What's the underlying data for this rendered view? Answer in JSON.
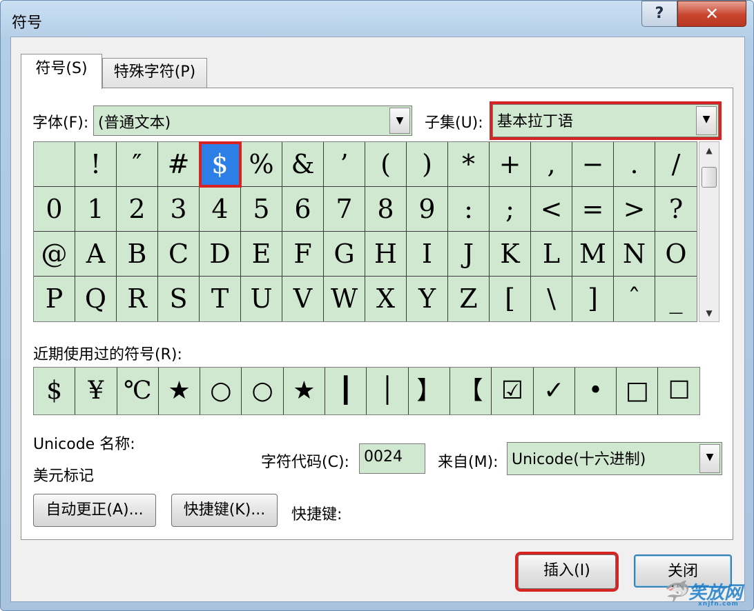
{
  "window": {
    "title": "符号",
    "help": "?",
    "close": "✕"
  },
  "tabs": [
    {
      "label": "符号(S)",
      "active": true
    },
    {
      "label": "特殊字符(P)",
      "active": false
    }
  ],
  "font": {
    "label": "字体(F):",
    "value": "(普通文本)",
    "arrow": "▼"
  },
  "subset": {
    "label": "子集(U):",
    "value": "基本拉丁语",
    "arrow": "▼"
  },
  "symbol_grid": {
    "rows": [
      [
        " ",
        "!",
        "″",
        "#",
        "$",
        "%",
        "&",
        "’",
        "(",
        ")",
        "*",
        "+",
        ",",
        "−",
        ".",
        "/"
      ],
      [
        "0",
        "1",
        "2",
        "3",
        "4",
        "5",
        "6",
        "7",
        "8",
        "9",
        ":",
        ";",
        "<",
        "=",
        ">",
        "?"
      ],
      [
        "@",
        "A",
        "B",
        "C",
        "D",
        "E",
        "F",
        "G",
        "H",
        "I",
        "J",
        "K",
        "L",
        "M",
        "N",
        "O"
      ],
      [
        "P",
        "Q",
        "R",
        "S",
        "T",
        "U",
        "V",
        "W",
        "X",
        "Y",
        "Z",
        "[",
        "\\",
        "]",
        "ˆ",
        "_"
      ]
    ],
    "selected": "$"
  },
  "scroll": {
    "up": "▲",
    "down": "▼"
  },
  "recent": {
    "label": "近期使用过的符号(R):",
    "symbols": [
      "$",
      "¥",
      "℃",
      "★",
      "○",
      "○",
      "★",
      "┃",
      "│",
      "】",
      "【",
      "☑",
      "✓",
      "•",
      "□",
      "☐"
    ]
  },
  "unicode": {
    "label": "Unicode 名称:",
    "value": "美元标记"
  },
  "char_code": {
    "label": "字符代码(C):",
    "value": "0024"
  },
  "from": {
    "label": "来自(M):",
    "value": "Unicode(十六进制)",
    "arrow": "▼"
  },
  "buttons": {
    "autocorrect": "自动更正(A)...",
    "shortcut_key": "快捷键(K)...",
    "shortcut_label": "快捷键:",
    "insert": "插入(I)",
    "close": "关闭"
  },
  "watermark": {
    "icon": "🦈",
    "text": "笑放网",
    "url": "xnjfn.com"
  }
}
